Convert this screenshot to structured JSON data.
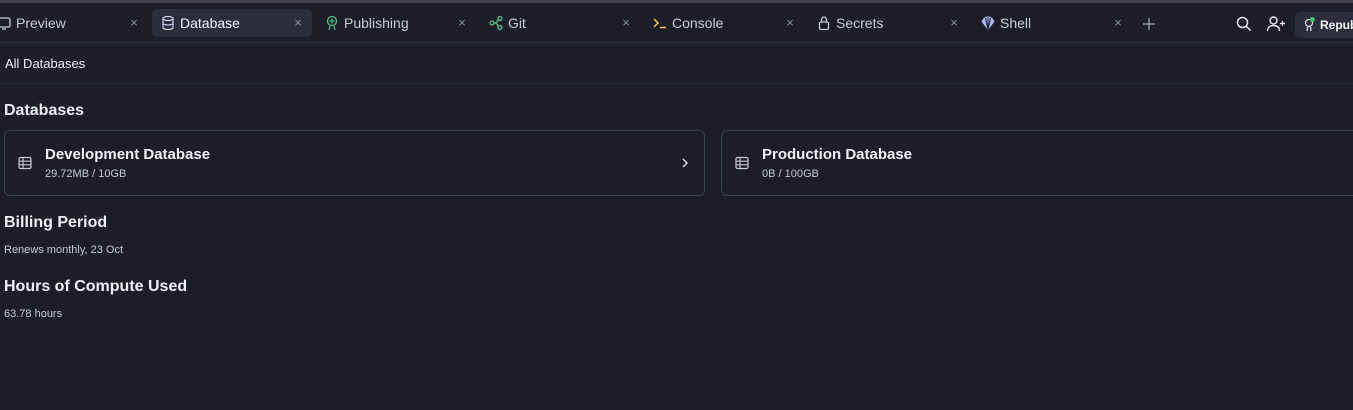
{
  "tabs": [
    {
      "label": "Preview",
      "icon": "preview-icon",
      "active": false
    },
    {
      "label": "Database",
      "icon": "database-icon",
      "active": true
    },
    {
      "label": "Publishing",
      "icon": "publishing-icon",
      "active": false
    },
    {
      "label": "Git",
      "icon": "git-icon",
      "active": false
    },
    {
      "label": "Console",
      "icon": "console-icon",
      "active": false
    },
    {
      "label": "Secrets",
      "icon": "lock-icon",
      "active": false
    },
    {
      "label": "Shell",
      "icon": "shell-icon",
      "active": false
    }
  ],
  "close_glyph": "×",
  "header": {
    "republish_label": "Republish",
    "status_color": "#3ec26b"
  },
  "breadcrumb": "All Databases",
  "databases": {
    "title": "Databases",
    "items": [
      {
        "name": "Development Database",
        "usage": "29.72MB / 10GB"
      },
      {
        "name": "Production Database",
        "usage": "0B / 100GB"
      }
    ]
  },
  "billing": {
    "title": "Billing Period",
    "value": "Renews monthly, 23 Oct"
  },
  "compute": {
    "title": "Hours of Compute Used",
    "value": "63.78 hours"
  },
  "colors": {
    "background": "#1c1d26",
    "active_tab": "#2b2d3a",
    "publishing_accent": "#4fc28d",
    "git_accent": "#4fc28d",
    "console_accent": "#f2c94c",
    "shell_accent": "#a9b8f0"
  }
}
